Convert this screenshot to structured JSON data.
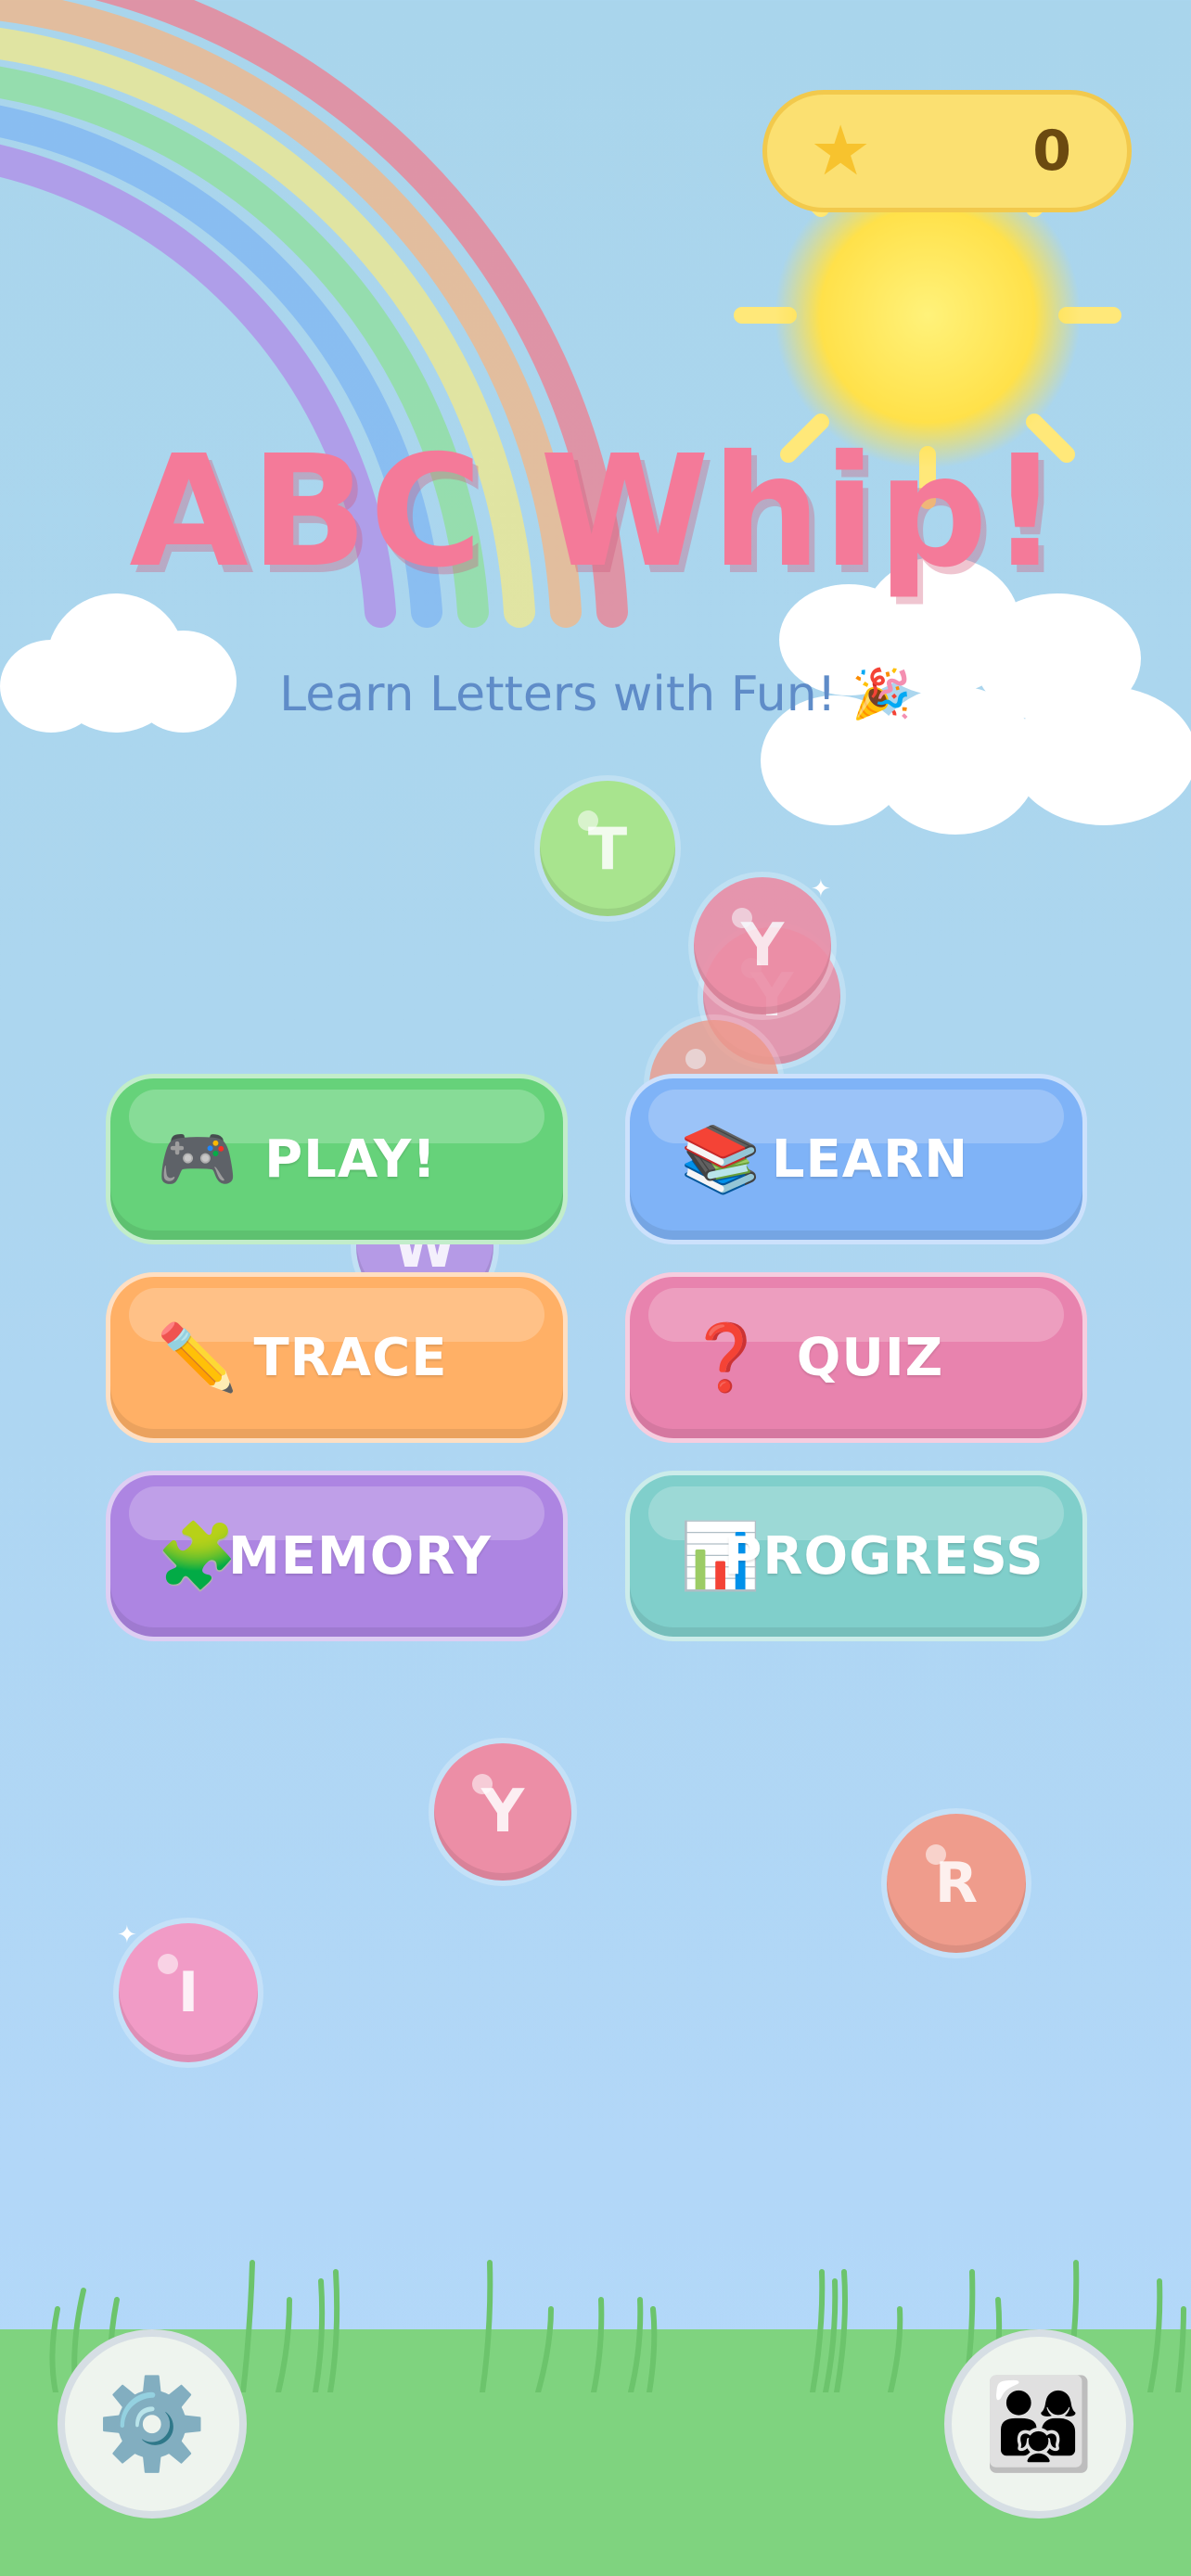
{
  "app": {
    "title": "ABC Whip!",
    "subtitle": "Learn Letters with Fun! 🎉"
  },
  "score": {
    "icon": "star-icon",
    "value": "0"
  },
  "menu": [
    {
      "label": "PLAY!",
      "icon": "🎮",
      "icon_name": "game-controller-icon",
      "color": "#66d27a"
    },
    {
      "label": "LEARN",
      "icon": "📚",
      "icon_name": "books-icon",
      "color": "#7fb3f7"
    },
    {
      "label": "TRACE",
      "icon": "✏️",
      "icon_name": "pencil-icon",
      "color": "#ffb066"
    },
    {
      "label": "QUIZ",
      "icon": "❓",
      "icon_name": "question-mark-icon",
      "color": "#e883ae"
    },
    {
      "label": "MEMORY",
      "icon": "🧩",
      "icon_name": "puzzle-piece-icon",
      "color": "#ad85e2"
    },
    {
      "label": "PROGRESS",
      "icon": "📊",
      "icon_name": "bar-chart-icon",
      "color": "#80cfcb"
    }
  ],
  "bubbles": [
    {
      "letter": "T",
      "color": "#a8e48e"
    },
    {
      "letter": "Y",
      "color": "#ec8ea6"
    },
    {
      "letter": "Y",
      "color": "#ec8ea6"
    },
    {
      "letter": "W",
      "color": "#b59ae6"
    },
    {
      "letter": "Y",
      "color": "#ec8ea6"
    },
    {
      "letter": "R",
      "color": "#ef9c8c"
    },
    {
      "letter": "I",
      "color": "#f19bc6"
    }
  ],
  "bottom": {
    "settings_icon": "⚙️",
    "settings_name": "gear-icon",
    "parents_icon": "👨‍👩‍👧",
    "parents_name": "family-icon"
  }
}
